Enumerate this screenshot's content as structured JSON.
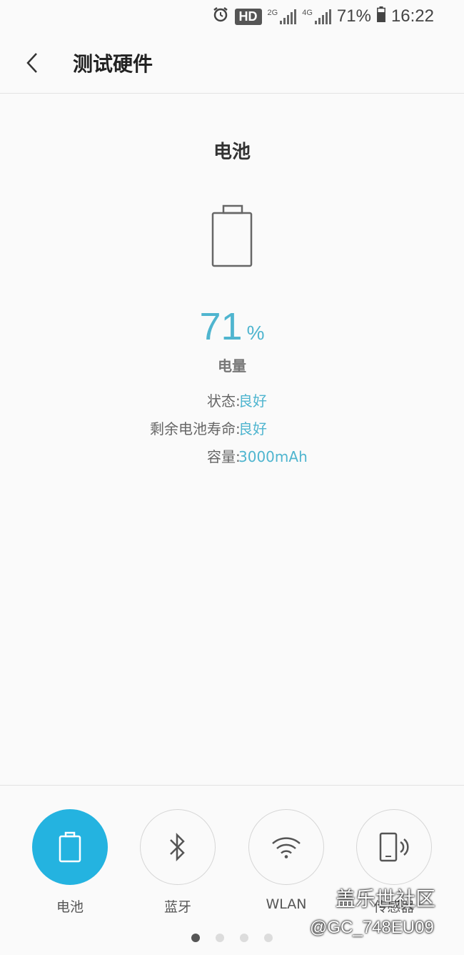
{
  "status_bar": {
    "hd": "HD",
    "sim1": "2G",
    "sim2": "4G",
    "battery": "71%",
    "time": "16:22"
  },
  "header": {
    "title": "测试硬件"
  },
  "battery": {
    "section_title": "电池",
    "level_value": "71",
    "level_unit": "%",
    "level_caption": "电量",
    "rows": [
      {
        "label": "状态",
        "value": "良好"
      },
      {
        "label": "剩余电池寿命",
        "value": "良好"
      },
      {
        "label": "容量",
        "value": "3000mAh"
      }
    ]
  },
  "tabs": [
    {
      "label": "电池",
      "icon": "battery-icon",
      "active": true
    },
    {
      "label": "蓝牙",
      "icon": "bluetooth-icon",
      "active": false
    },
    {
      "label": "WLAN",
      "icon": "wifi-icon",
      "active": false
    },
    {
      "label": "传感器",
      "icon": "phone-vibrate-icon",
      "active": false
    }
  ],
  "pager": {
    "count": 4,
    "active_index": 0
  },
  "watermark": {
    "line1": "盖乐世社区",
    "line2": "@GC_748EU09"
  },
  "colors": {
    "accent": "#24b3e0",
    "value_text": "#4fb5cf"
  }
}
